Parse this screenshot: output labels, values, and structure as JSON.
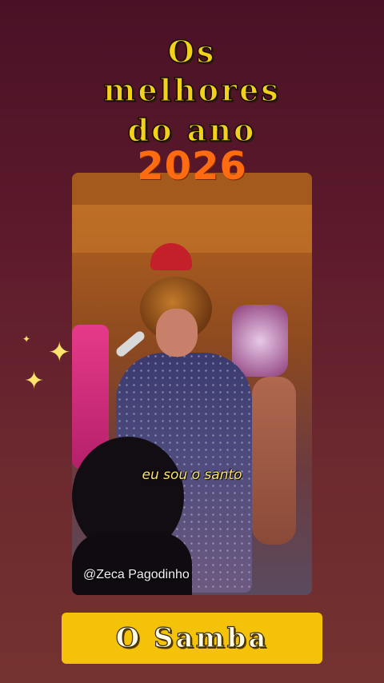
{
  "title": {
    "line1": "Os",
    "line2": "melhores",
    "line3": "do ano",
    "year": "2026"
  },
  "video": {
    "caption": "eu sou o santo",
    "watermark": "@Zeca Pagodinho"
  },
  "decorations": {
    "sparkle_icon": "sparkle-star",
    "accent_color": "#f2d11a",
    "year_color": "#ff6b10",
    "banner_color": "#f5c20a"
  },
  "bottom_banner": {
    "label": "O Samba"
  }
}
